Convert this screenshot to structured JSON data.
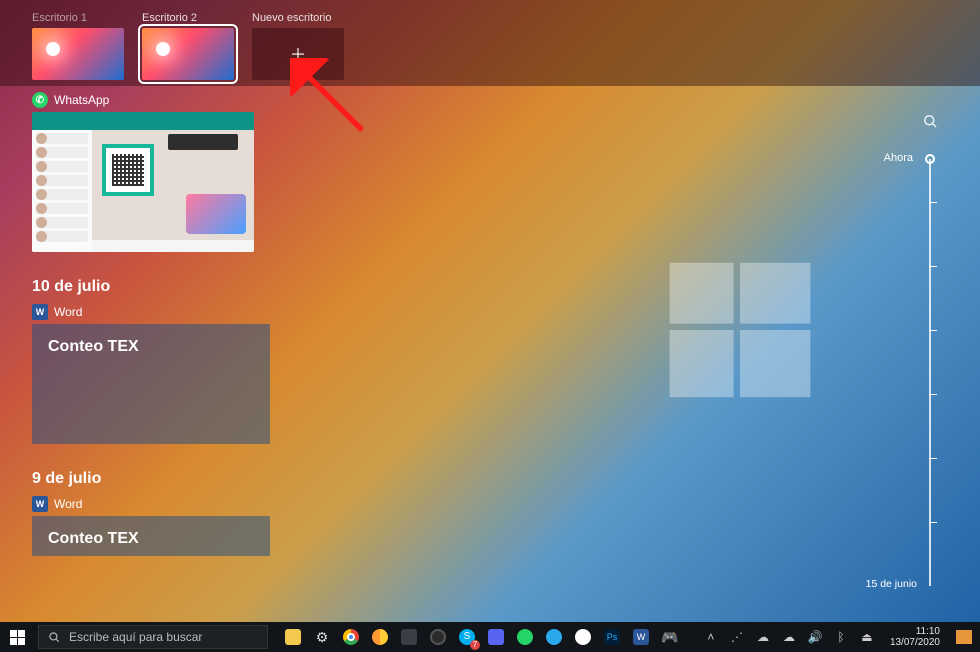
{
  "desktops": {
    "items": [
      {
        "label": "Escritorio 1",
        "active": false
      },
      {
        "label": "Escritorio 2",
        "active": true
      }
    ],
    "new_label": "Nuevo escritorio"
  },
  "timeline": {
    "current": {
      "app_name": "WhatsApp"
    },
    "groups": [
      {
        "date_label": "10 de julio",
        "app_name": "Word",
        "doc_title": "Conteo TEX"
      },
      {
        "date_label": "9 de julio",
        "app_name": "Word",
        "doc_title": "Conteo TEX"
      }
    ]
  },
  "scrubber": {
    "now_label": "Ahora",
    "bottom_label": "15 de junio"
  },
  "taskbar": {
    "search_placeholder": "Escribe aquí para buscar",
    "skype_badge": "7",
    "time": "11:10",
    "date": "13/07/2020"
  }
}
